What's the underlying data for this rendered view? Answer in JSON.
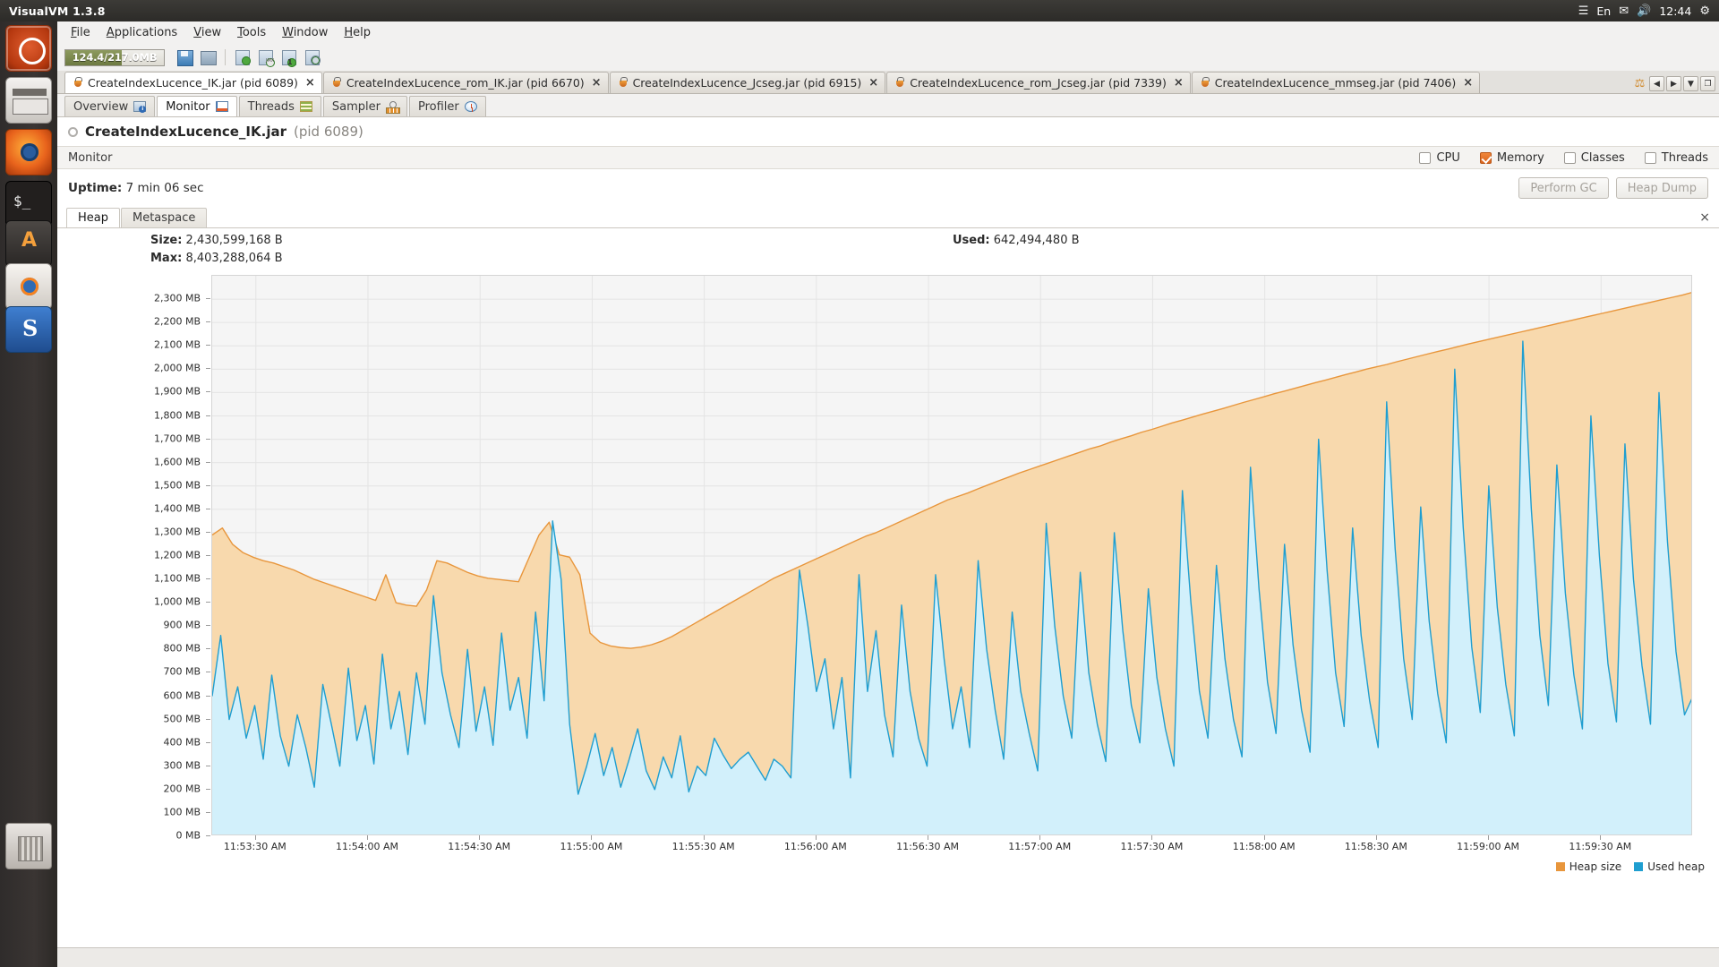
{
  "desktop": {
    "panel_title": "VisualVM 1.3.8",
    "tray": {
      "wifi_icon": "wifi-icon",
      "keyboard_label": "En",
      "mail_icon": "mail-icon",
      "volume_icon": "volume-icon",
      "clock": "12:44",
      "power_icon": "power-icon"
    },
    "launcher_items": [
      {
        "name": "ubuntu-dash",
        "label": "Dash Home"
      },
      {
        "name": "files",
        "label": "Files"
      },
      {
        "name": "firefox",
        "label": "Firefox"
      },
      {
        "name": "terminal",
        "label": "Terminal"
      },
      {
        "name": "software-center",
        "label": "Ubuntu Software Center"
      },
      {
        "name": "amarok",
        "label": "Amarok"
      },
      {
        "name": "blue-app",
        "label": "Application"
      },
      {
        "name": "trash",
        "label": "Trash"
      }
    ]
  },
  "menu": {
    "items": [
      {
        "label": "File",
        "mnemonic": "F"
      },
      {
        "label": "Applications",
        "mnemonic": "A"
      },
      {
        "label": "View",
        "mnemonic": "V"
      },
      {
        "label": "Tools",
        "mnemonic": "T"
      },
      {
        "label": "Window",
        "mnemonic": "W"
      },
      {
        "label": "Help",
        "mnemonic": "H"
      }
    ]
  },
  "toolbar": {
    "heap_monitor": "124.4/217.0MB",
    "heap_monitor_percent": 57,
    "buttons": [
      {
        "name": "save-snapshot-button",
        "icon": "save-icon"
      },
      {
        "name": "save-all-button",
        "icon": "save-all-icon"
      },
      {
        "name": "add-jmx-connection-button",
        "icon": "add-application-icon"
      },
      {
        "name": "add-jmx-button",
        "icon": "add-jmx-icon"
      },
      {
        "name": "add-remote-host-button",
        "icon": "add-host-icon"
      },
      {
        "name": "add-local-button",
        "icon": "add-local-icon"
      }
    ]
  },
  "app_tabs": {
    "tabs": [
      {
        "label": "CreateIndexLucence_IK.jar (pid 6089)",
        "selected": true
      },
      {
        "label": "CreateIndexLucence_rom_IK.jar (pid 6670)",
        "selected": false
      },
      {
        "label": "CreateIndexLucence_Jcseg.jar (pid 6915)",
        "selected": false
      },
      {
        "label": "CreateIndexLucence_rom_Jcseg.jar (pid 7339)",
        "selected": false
      },
      {
        "label": "CreateIndexLucence_mmseg.jar (pid 7406)",
        "selected": false
      }
    ],
    "nav": {
      "scroll_left": "◀",
      "scroll_right": "▶",
      "list": "▼",
      "maximize": "❐"
    }
  },
  "view_tabs": [
    {
      "label": "Overview",
      "icon": "overview-icon",
      "selected": false
    },
    {
      "label": "Monitor",
      "icon": "monitor-icon",
      "selected": true
    },
    {
      "label": "Threads",
      "icon": "threads-icon",
      "selected": false
    },
    {
      "label": "Sampler",
      "icon": "sampler-icon",
      "selected": false
    },
    {
      "label": "Profiler",
      "icon": "profiler-icon",
      "selected": false
    }
  ],
  "app_header": {
    "name": "CreateIndexLucence_IK.jar",
    "pid": "(pid 6089)"
  },
  "monitor_bar": {
    "title": "Monitor",
    "checkboxes": [
      {
        "label": "CPU",
        "checked": false
      },
      {
        "label": "Memory",
        "checked": true
      },
      {
        "label": "Classes",
        "checked": false
      },
      {
        "label": "Threads",
        "checked": false
      }
    ],
    "accent_color": "#e2702a"
  },
  "uptime_row": {
    "label": "Uptime:",
    "value": "7 min 06 sec",
    "perform_gc": "Perform GC",
    "heap_dump": "Heap Dump"
  },
  "heap_tabs": [
    {
      "label": "Heap",
      "selected": true
    },
    {
      "label": "Metaspace",
      "selected": false
    }
  ],
  "heap_tabs_close": "×",
  "stats": {
    "size_label": "Size:",
    "size_value": "2,430,599,168 B",
    "max_label": "Max:",
    "max_value": "8,403,288,064 B",
    "used_label": "Used:",
    "used_value": "642,494,480 B"
  },
  "chart_data": {
    "type": "area",
    "title": "Heap",
    "xlabel": "",
    "ylabel": "",
    "grid": true,
    "legend_position": "bottom-right",
    "ylim": [
      0,
      2400
    ],
    "y_unit": "MB",
    "yticks": [
      0,
      100,
      200,
      300,
      400,
      500,
      600,
      700,
      800,
      900,
      1000,
      1100,
      1200,
      1300,
      1400,
      1500,
      1600,
      1700,
      1800,
      1900,
      2000,
      2100,
      2200,
      2300
    ],
    "ytick_labels": [
      "0 MB",
      "100 MB",
      "200 MB",
      "300 MB",
      "400 MB",
      "500 MB",
      "600 MB",
      "700 MB",
      "800 MB",
      "900 MB",
      "1,000 MB",
      "1,100 MB",
      "1,200 MB",
      "1,300 MB",
      "1,400 MB",
      "1,500 MB",
      "1,600 MB",
      "1,700 MB",
      "1,800 MB",
      "1,900 MB",
      "2,000 MB",
      "2,100 MB",
      "2,200 MB",
      "2,300 MB"
    ],
    "xtick_labels": [
      "11:53:30 AM",
      "11:54:00 AM",
      "11:54:30 AM",
      "11:55:00 AM",
      "11:55:30 AM",
      "11:56:00 AM",
      "11:56:30 AM",
      "11:57:00 AM",
      "11:57:30 AM",
      "11:58:00 AM",
      "11:58:30 AM",
      "11:59:00 AM",
      "11:59:30 AM"
    ],
    "xlim_minutes": [
      713.35,
      719.9
    ],
    "series": [
      {
        "name": "Heap size",
        "color": "#e8963c",
        "fill": "#f8d9ad",
        "values": [
          1290,
          1320,
          1250,
          1215,
          1195,
          1180,
          1170,
          1155,
          1140,
          1120,
          1100,
          1085,
          1070,
          1055,
          1040,
          1025,
          1010,
          1120,
          1000,
          990,
          985,
          1055,
          1180,
          1170,
          1150,
          1130,
          1115,
          1105,
          1100,
          1095,
          1090,
          1190,
          1290,
          1345,
          1205,
          1195,
          1120,
          870,
          830,
          815,
          808,
          805,
          810,
          820,
          835,
          855,
          880,
          905,
          930,
          955,
          980,
          1005,
          1030,
          1055,
          1080,
          1105,
          1125,
          1145,
          1165,
          1185,
          1205,
          1225,
          1245,
          1265,
          1285,
          1300,
          1320,
          1340,
          1360,
          1380,
          1400,
          1420,
          1440,
          1455,
          1470,
          1488,
          1505,
          1522,
          1538,
          1555,
          1570,
          1585,
          1600,
          1615,
          1630,
          1645,
          1660,
          1672,
          1688,
          1702,
          1715,
          1730,
          1742,
          1756,
          1770,
          1782,
          1795,
          1808,
          1820,
          1832,
          1845,
          1858,
          1870,
          1882,
          1895,
          1906,
          1918,
          1930,
          1942,
          1953,
          1965,
          1977,
          1988,
          2000,
          2010,
          2020,
          2032,
          2043,
          2054,
          2065,
          2076,
          2086,
          2097,
          2108,
          2118,
          2128,
          2138,
          2148,
          2158,
          2168,
          2178,
          2188,
          2198,
          2208,
          2218,
          2228,
          2238,
          2248,
          2258,
          2268,
          2278,
          2288,
          2298,
          2308,
          2318,
          2330
        ]
      },
      {
        "name": "Used heap",
        "color": "#1f9ed0",
        "fill": "#d2f0fb",
        "values": [
          600,
          860,
          500,
          640,
          420,
          560,
          330,
          690,
          430,
          300,
          520,
          380,
          210,
          650,
          480,
          300,
          720,
          410,
          560,
          310,
          780,
          460,
          620,
          350,
          700,
          480,
          1030,
          700,
          520,
          380,
          800,
          450,
          640,
          390,
          870,
          540,
          680,
          420,
          960,
          580,
          1350,
          1100,
          480,
          180,
          300,
          440,
          260,
          380,
          210,
          330,
          460,
          280,
          200,
          340,
          250,
          430,
          190,
          300,
          260,
          420,
          350,
          290,
          330,
          360,
          300,
          240,
          330,
          300,
          250,
          1140,
          900,
          620,
          760,
          460,
          680,
          250,
          1120,
          620,
          880,
          520,
          340,
          990,
          620,
          420,
          300,
          1120,
          760,
          460,
          640,
          380,
          1180,
          800,
          540,
          330,
          960,
          620,
          440,
          280,
          1340,
          900,
          600,
          420,
          1130,
          700,
          480,
          320,
          1300,
          880,
          560,
          400,
          1060,
          680,
          460,
          300,
          1480,
          1000,
          620,
          420,
          1160,
          760,
          500,
          340,
          1580,
          1060,
          660,
          440,
          1250,
          820,
          540,
          360,
          1700,
          1140,
          700,
          470,
          1320,
          860,
          580,
          380,
          1860,
          1230,
          760,
          500,
          1410,
          920,
          610,
          400,
          2000,
          1320,
          810,
          530,
          1500,
          980,
          650,
          430,
          2120,
          1400,
          860,
          560,
          1590,
          1040,
          690,
          460,
          1800,
          1200,
          740,
          490,
          1680,
          1100,
          730,
          480,
          1900,
          1260,
          790,
          520,
          600
        ]
      }
    ]
  },
  "legend": [
    {
      "label": "Heap size",
      "color": "#e8963c"
    },
    {
      "label": "Used heap",
      "color": "#1f9ed0"
    }
  ]
}
